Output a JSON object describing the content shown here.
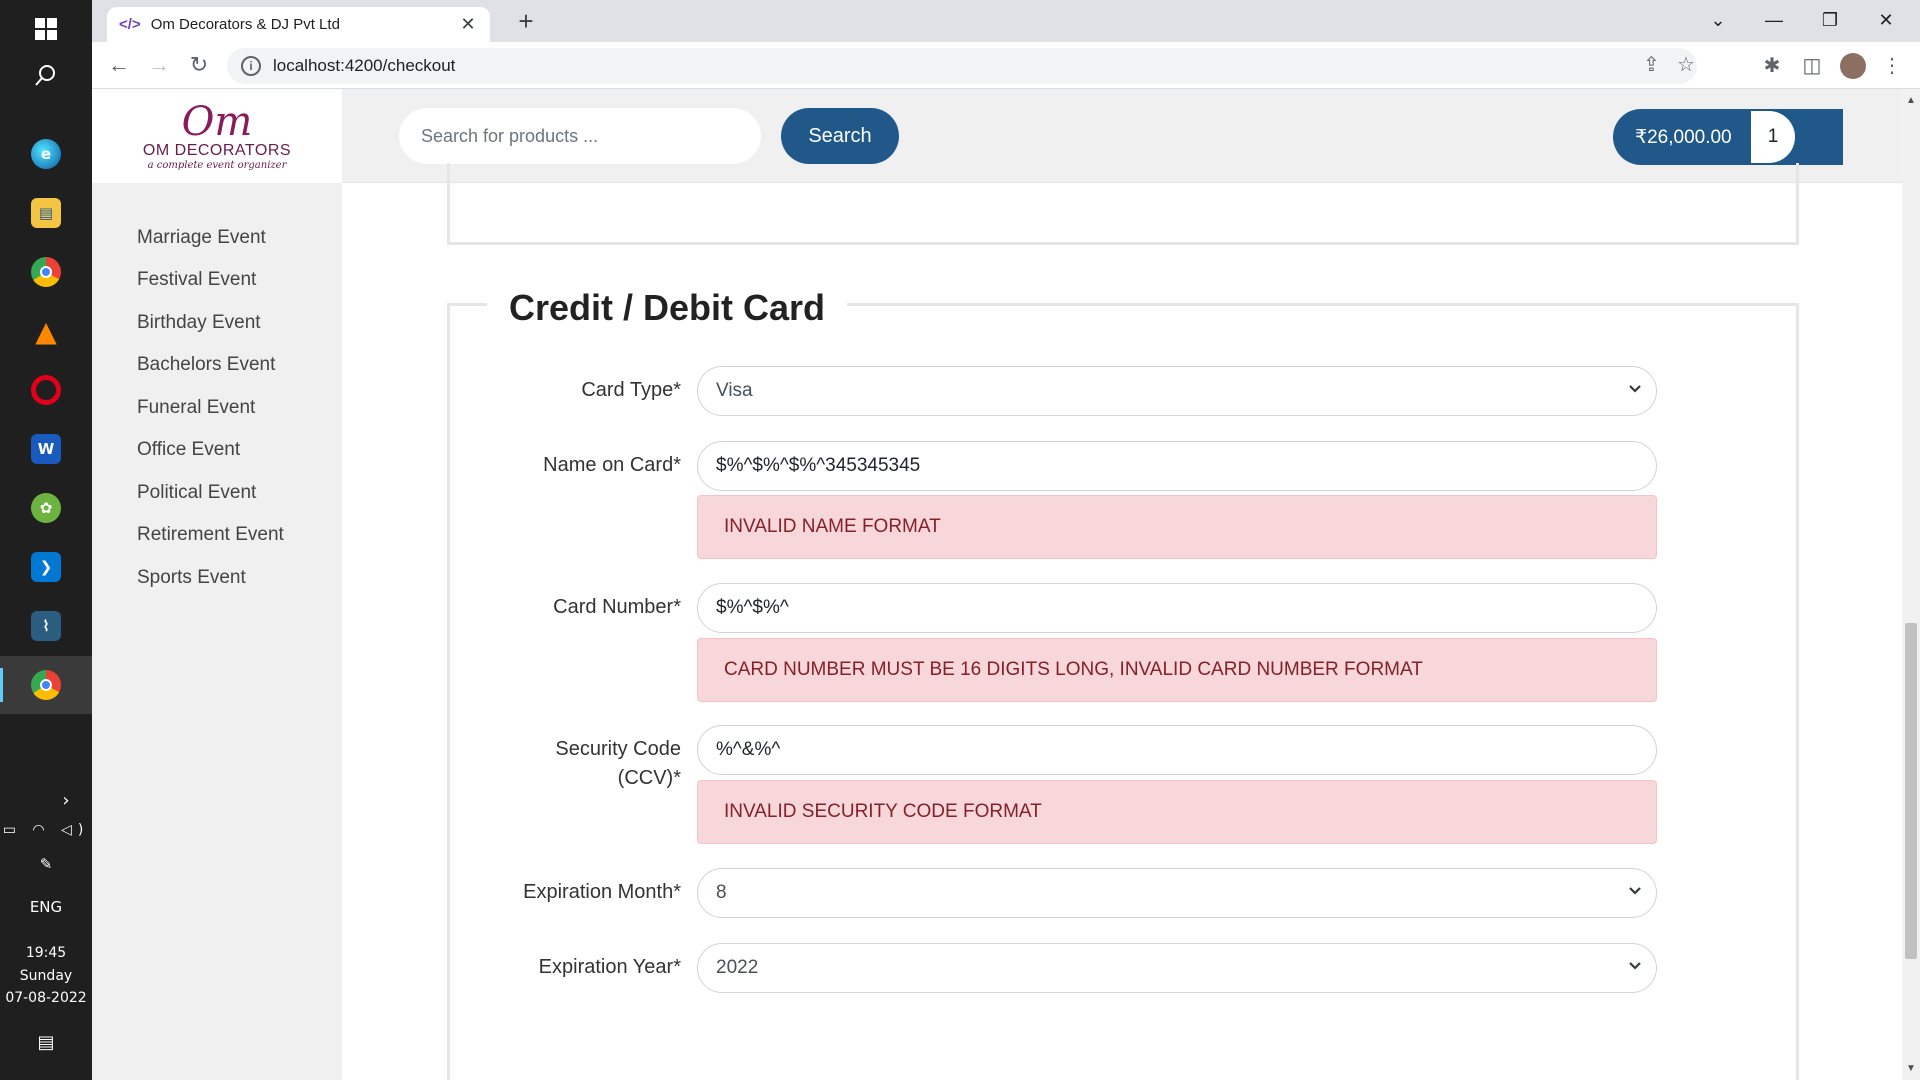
{
  "browser": {
    "tab_title": "Om Decorators & DJ Pvt Ltd",
    "tab_favicon": "</>",
    "url": "localhost:4200/checkout"
  },
  "taskbar": {
    "apps": [
      "windows-start-icon",
      "search-icon",
      "edge-icon",
      "file-explorer-icon",
      "chrome-icon",
      "vlc-icon",
      "opera-icon",
      "word-icon",
      "spring-icon",
      "vscode-icon",
      "mysql-workbench-icon",
      "chrome-profile-icon"
    ],
    "language": "ENG",
    "time": "19:45",
    "day": "Sunday",
    "date": "07-08-2022"
  },
  "site": {
    "logo": {
      "text": "OM DECORATORS",
      "tagline": "a complete event organizer"
    },
    "search_placeholder": "Search for products ...",
    "search_button": "Search",
    "cart_total": "₹26,000.00",
    "cart_count": "1"
  },
  "sidebar": {
    "items": [
      {
        "label": "Marriage Event"
      },
      {
        "label": "Festival Event"
      },
      {
        "label": "Birthday Event"
      },
      {
        "label": "Bachelors Event"
      },
      {
        "label": "Funeral Event"
      },
      {
        "label": "Office Event"
      },
      {
        "label": "Political Event"
      },
      {
        "label": "Retirement Event"
      },
      {
        "label": "Sports Event"
      }
    ]
  },
  "form": {
    "legend": "Credit / Debit Card",
    "card_type": {
      "label": "Card Type*",
      "value": "Visa"
    },
    "name_on_card": {
      "label": "Name on Card*",
      "value": "$%^$%^$%^345345345",
      "error": "INVALID NAME FORMAT"
    },
    "card_number": {
      "label": "Card Number*",
      "value": "$%^$%^",
      "error": "CARD NUMBER MUST BE 16 DIGITS LONG, INVALID CARD NUMBER FORMAT"
    },
    "security_code": {
      "label_line1": "Security Code",
      "label_line2": "(CCV)*",
      "value": "%^&%^",
      "error": "INVALID SECURITY CODE FORMAT"
    },
    "expiration_month": {
      "label": "Expiration Month*",
      "value": "8"
    },
    "expiration_year": {
      "label": "Expiration Year*",
      "value": "2022"
    }
  },
  "colors": {
    "primary": "#1f5889",
    "alert_bg": "#f8d7da",
    "alert_text": "#842029"
  }
}
